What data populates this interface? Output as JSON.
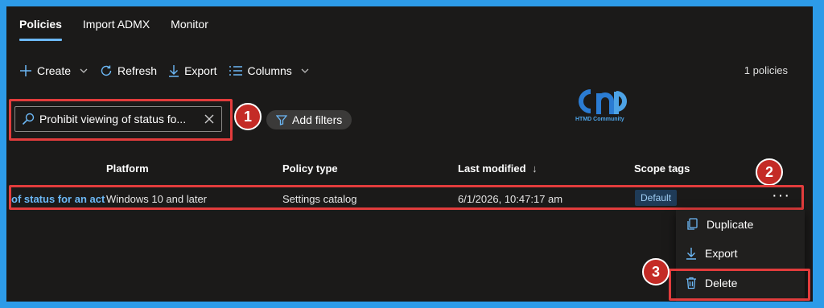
{
  "tabs": [
    {
      "label": "Policies",
      "active": true
    },
    {
      "label": "Import ADMX",
      "active": false
    },
    {
      "label": "Monitor",
      "active": false
    }
  ],
  "toolbar": {
    "create_label": "Create",
    "refresh_label": "Refresh",
    "export_label": "Export",
    "columns_label": "Columns",
    "policy_count": "1 policies"
  },
  "search": {
    "value": "Prohibit viewing of status fo..."
  },
  "filters": {
    "add_label": "Add filters"
  },
  "watermark": {
    "brand": "HTMD Community"
  },
  "callouts": [
    "1",
    "2",
    "3"
  ],
  "table": {
    "columns": [
      "Platform",
      "Policy type",
      "Last modified",
      "Scope tags"
    ],
    "rows": [
      {
        "name": "of status for an act",
        "platform": "Windows 10 and later",
        "policy_type": "Settings catalog",
        "last_modified": "6/1/2026, 10:47:17 am",
        "scope_tag": "Default"
      }
    ]
  },
  "context_menu": {
    "items": [
      "Duplicate",
      "Export",
      "Delete"
    ]
  },
  "colors": {
    "accent": "#6cb8f6",
    "highlight": "#e23c3c",
    "callout": "#c42b26",
    "background": "#1b1a19",
    "outer_border": "#2d9be8"
  }
}
